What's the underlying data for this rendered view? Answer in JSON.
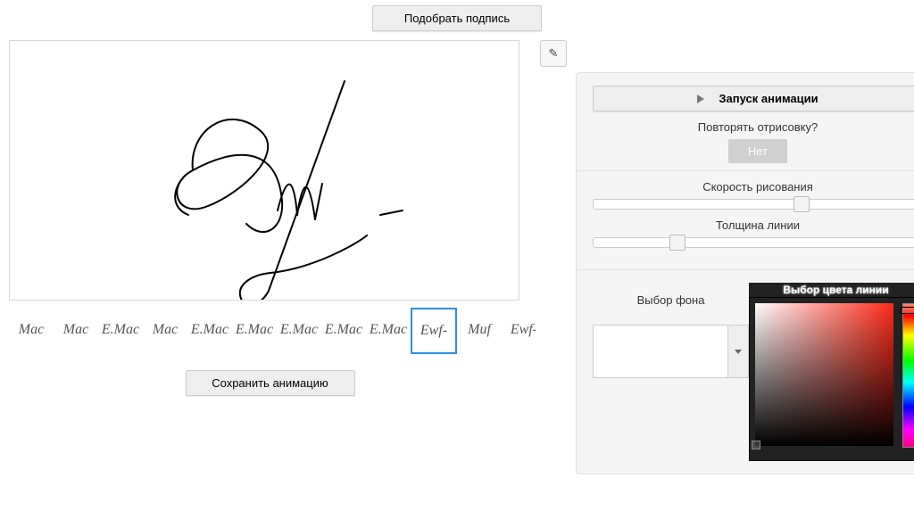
{
  "top_button": "Подобрать подпись",
  "save_button": "Сохранить анимацию",
  "settings_icon_glyph": "✎",
  "animation": {
    "run_label": "Запуск анимации",
    "repeat_label": "Повторять отрисовку?",
    "repeat_value": "Нет",
    "speed_label": "Скорость рисования",
    "speed_value_pct": 61,
    "thickness_label": "Толщина линии",
    "thickness_value_pct": 23
  },
  "bg": {
    "label": "Выбор фона",
    "color": "#ffffff"
  },
  "line_color": {
    "title": "Выбор цвета линии",
    "hue_pos_pct": 2
  },
  "thumbs": [
    {
      "label": "Mac",
      "selected": false
    },
    {
      "label": "Mac",
      "selected": false
    },
    {
      "label": "E.Mac",
      "selected": false
    },
    {
      "label": "Mac",
      "selected": false
    },
    {
      "label": "E.Mac",
      "selected": false
    },
    {
      "label": "E.Mac",
      "selected": false
    },
    {
      "label": "E.Mac",
      "selected": false
    },
    {
      "label": "E.Mac",
      "selected": false
    },
    {
      "label": "E.Mac",
      "selected": false
    },
    {
      "label": "Ewf-",
      "selected": true
    },
    {
      "label": "Muf",
      "selected": false
    },
    {
      "label": "Ewf-",
      "selected": false
    }
  ]
}
